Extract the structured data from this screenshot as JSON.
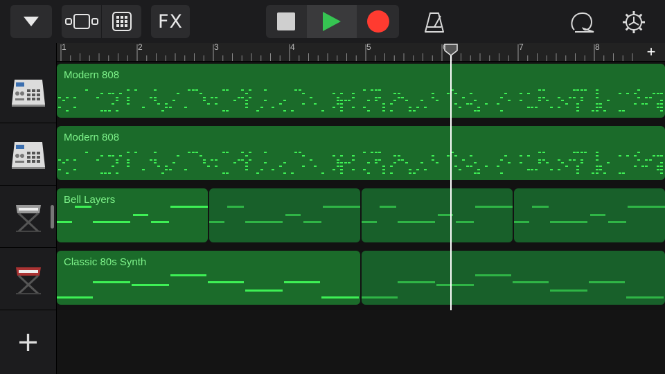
{
  "toolbar": {
    "fx_label": "FX",
    "buttons": [
      "menu-dropdown",
      "view-switch",
      "grid-view",
      "fx",
      "stop",
      "play",
      "record",
      "metronome",
      "loop-browser",
      "settings"
    ],
    "colors": {
      "play": "#36c452",
      "record": "#ff3b30",
      "stop": "#cfcfcf"
    }
  },
  "ruler": {
    "bars": [
      "1",
      "2",
      "3",
      "4",
      "5",
      "6",
      "7",
      "8"
    ],
    "add_label": "+"
  },
  "tracks": [
    {
      "name": "Modern 808",
      "instrument": "drum-machine-icon",
      "region_count": 1
    },
    {
      "name": "Modern 808",
      "instrument": "drum-machine-icon",
      "region_count": 1
    },
    {
      "name": "Bell Layers",
      "instrument": "keyboard-stand-icon",
      "region_count": 4
    },
    {
      "name": "Classic 80s Synth",
      "instrument": "keyboard-stand-icon",
      "region_count": 2
    }
  ],
  "add_track_label": "+",
  "colors": {
    "region_green": "#1b6b2a",
    "note_green": "#3ef055",
    "region_text": "#7ef38a"
  }
}
